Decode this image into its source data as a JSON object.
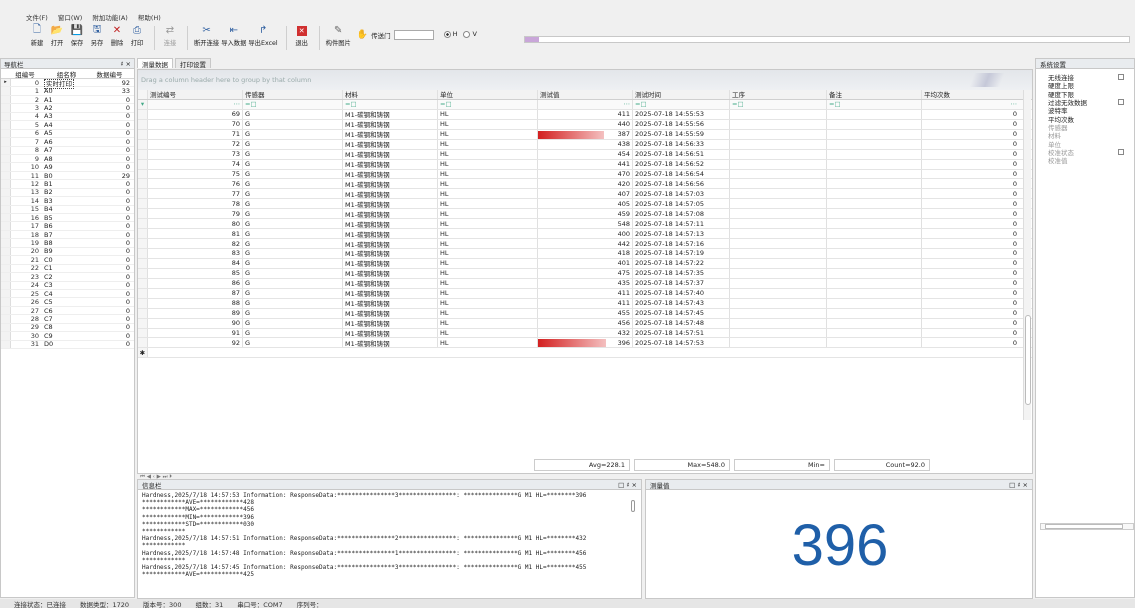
{
  "menu": [
    "文件(F)",
    "窗口(W)",
    "附加功能(A)",
    "帮助(H)"
  ],
  "toolbar": {
    "buttons": [
      {
        "label": "新建",
        "icon": "new-file-icon"
      },
      {
        "label": "打开",
        "icon": "open-folder-icon"
      },
      {
        "label": "保存",
        "icon": "save-icon"
      },
      {
        "label": "另存",
        "icon": "save-as-icon"
      },
      {
        "label": "删除",
        "icon": "delete-icon"
      },
      {
        "label": "打印",
        "icon": "print-icon"
      }
    ],
    "connect_label": "连接",
    "reconnect_label": "断开连接",
    "import_label": "导入数据",
    "export_label": "导出Excel",
    "exit_label": "退出",
    "image_label": "构件图片",
    "port_label": "传送门",
    "radio_h": "H",
    "radio_v": "V",
    "radio_selected": "H"
  },
  "nav": {
    "title": "导航栏",
    "pin": "♯",
    "close": "×",
    "headers": [
      "组编号",
      "组名称",
      "数据编号"
    ],
    "rows": [
      {
        "id": "0",
        "name": "实时打印",
        "count": "92",
        "selected": true
      },
      {
        "id": "1",
        "name": "A0",
        "count": "33"
      },
      {
        "id": "2",
        "name": "A1",
        "count": "0"
      },
      {
        "id": "3",
        "name": "A2",
        "count": "0"
      },
      {
        "id": "4",
        "name": "A3",
        "count": "0"
      },
      {
        "id": "5",
        "name": "A4",
        "count": "0"
      },
      {
        "id": "6",
        "name": "A5",
        "count": "0"
      },
      {
        "id": "7",
        "name": "A6",
        "count": "0"
      },
      {
        "id": "8",
        "name": "A7",
        "count": "0"
      },
      {
        "id": "9",
        "name": "A8",
        "count": "0"
      },
      {
        "id": "10",
        "name": "A9",
        "count": "0"
      },
      {
        "id": "11",
        "name": "B0",
        "count": "29"
      },
      {
        "id": "12",
        "name": "B1",
        "count": "0"
      },
      {
        "id": "13",
        "name": "B2",
        "count": "0"
      },
      {
        "id": "14",
        "name": "B3",
        "count": "0"
      },
      {
        "id": "15",
        "name": "B4",
        "count": "0"
      },
      {
        "id": "16",
        "name": "B5",
        "count": "0"
      },
      {
        "id": "17",
        "name": "B6",
        "count": "0"
      },
      {
        "id": "18",
        "name": "B7",
        "count": "0"
      },
      {
        "id": "19",
        "name": "B8",
        "count": "0"
      },
      {
        "id": "20",
        "name": "B9",
        "count": "0"
      },
      {
        "id": "21",
        "name": "C0",
        "count": "0"
      },
      {
        "id": "22",
        "name": "C1",
        "count": "0"
      },
      {
        "id": "23",
        "name": "C2",
        "count": "0"
      },
      {
        "id": "24",
        "name": "C3",
        "count": "0"
      },
      {
        "id": "25",
        "name": "C4",
        "count": "0"
      },
      {
        "id": "26",
        "name": "C5",
        "count": "0"
      },
      {
        "id": "27",
        "name": "C6",
        "count": "0"
      },
      {
        "id": "28",
        "name": "C7",
        "count": "0"
      },
      {
        "id": "29",
        "name": "C8",
        "count": "0"
      },
      {
        "id": "30",
        "name": "C9",
        "count": "0"
      },
      {
        "id": "31",
        "name": "D0",
        "count": "0"
      }
    ]
  },
  "tabs": [
    "测量数据",
    "打印设置"
  ],
  "grid": {
    "group_hint": "Drag a column header here to group by that column",
    "headers": [
      "测试编号",
      "传感器",
      "材料",
      "单位",
      "测试值",
      "测试时间",
      "工序",
      "备注",
      "平均次数"
    ],
    "filter_marks": [
      "⋯",
      "=□",
      "=□",
      "=□",
      "⋯",
      "=□",
      "=□",
      "=□",
      "⋯"
    ],
    "bar_max": 548,
    "rows": [
      {
        "no": "69",
        "sensor": "G",
        "material": "M1-碳钢和铸钢",
        "unit": "HL",
        "value": 411,
        "time": "2025-07-18 14:55:53",
        "avg": "0"
      },
      {
        "no": "70",
        "sensor": "G",
        "material": "M1-碳钢和铸钢",
        "unit": "HL",
        "value": 440,
        "time": "2025-07-18 14:55:56",
        "avg": "0"
      },
      {
        "no": "71",
        "sensor": "G",
        "material": "M1-碳钢和铸钢",
        "unit": "HL",
        "value": 387,
        "time": "2025-07-18 14:55:59",
        "avg": "0",
        "bar": true
      },
      {
        "no": "72",
        "sensor": "G",
        "material": "M1-碳钢和铸钢",
        "unit": "HL",
        "value": 438,
        "time": "2025-07-18 14:56:33",
        "avg": "0"
      },
      {
        "no": "73",
        "sensor": "G",
        "material": "M1-碳钢和铸钢",
        "unit": "HL",
        "value": 454,
        "time": "2025-07-18 14:56:51",
        "avg": "0"
      },
      {
        "no": "74",
        "sensor": "G",
        "material": "M1-碳钢和铸钢",
        "unit": "HL",
        "value": 441,
        "time": "2025-07-18 14:56:52",
        "avg": "0"
      },
      {
        "no": "75",
        "sensor": "G",
        "material": "M1-碳钢和铸钢",
        "unit": "HL",
        "value": 470,
        "time": "2025-07-18 14:56:54",
        "avg": "0"
      },
      {
        "no": "76",
        "sensor": "G",
        "material": "M1-碳钢和铸钢",
        "unit": "HL",
        "value": 420,
        "time": "2025-07-18 14:56:56",
        "avg": "0"
      },
      {
        "no": "77",
        "sensor": "G",
        "material": "M1-碳钢和铸钢",
        "unit": "HL",
        "value": 407,
        "time": "2025-07-18 14:57:03",
        "avg": "0"
      },
      {
        "no": "78",
        "sensor": "G",
        "material": "M1-碳钢和铸钢",
        "unit": "HL",
        "value": 405,
        "time": "2025-07-18 14:57:05",
        "avg": "0"
      },
      {
        "no": "79",
        "sensor": "G",
        "material": "M1-碳钢和铸钢",
        "unit": "HL",
        "value": 459,
        "time": "2025-07-18 14:57:08",
        "avg": "0"
      },
      {
        "no": "80",
        "sensor": "G",
        "material": "M1-碳钢和铸钢",
        "unit": "HL",
        "value": 548,
        "time": "2025-07-18 14:57:11",
        "avg": "0"
      },
      {
        "no": "81",
        "sensor": "G",
        "material": "M1-碳钢和铸钢",
        "unit": "HL",
        "value": 400,
        "time": "2025-07-18 14:57:13",
        "avg": "0"
      },
      {
        "no": "82",
        "sensor": "G",
        "material": "M1-碳钢和铸钢",
        "unit": "HL",
        "value": 442,
        "time": "2025-07-18 14:57:16",
        "avg": "0"
      },
      {
        "no": "83",
        "sensor": "G",
        "material": "M1-碳钢和铸钢",
        "unit": "HL",
        "value": 418,
        "time": "2025-07-18 14:57:19",
        "avg": "0"
      },
      {
        "no": "84",
        "sensor": "G",
        "material": "M1-碳钢和铸钢",
        "unit": "HL",
        "value": 401,
        "time": "2025-07-18 14:57:22",
        "avg": "0"
      },
      {
        "no": "85",
        "sensor": "G",
        "material": "M1-碳钢和铸钢",
        "unit": "HL",
        "value": 475,
        "time": "2025-07-18 14:57:35",
        "avg": "0"
      },
      {
        "no": "86",
        "sensor": "G",
        "material": "M1-碳钢和铸钢",
        "unit": "HL",
        "value": 435,
        "time": "2025-07-18 14:57:37",
        "avg": "0"
      },
      {
        "no": "87",
        "sensor": "G",
        "material": "M1-碳钢和铸钢",
        "unit": "HL",
        "value": 411,
        "time": "2025-07-18 14:57:40",
        "avg": "0"
      },
      {
        "no": "88",
        "sensor": "G",
        "material": "M1-碳钢和铸钢",
        "unit": "HL",
        "value": 411,
        "time": "2025-07-18 14:57:43",
        "avg": "0"
      },
      {
        "no": "89",
        "sensor": "G",
        "material": "M1-碳钢和铸钢",
        "unit": "HL",
        "value": 455,
        "time": "2025-07-18 14:57:45",
        "avg": "0"
      },
      {
        "no": "90",
        "sensor": "G",
        "material": "M1-碳钢和铸钢",
        "unit": "HL",
        "value": 456,
        "time": "2025-07-18 14:57:48",
        "avg": "0"
      },
      {
        "no": "91",
        "sensor": "G",
        "material": "M1-碳钢和铸钢",
        "unit": "HL",
        "value": 432,
        "time": "2025-07-18 14:57:51",
        "avg": "0"
      },
      {
        "no": "92",
        "sensor": "G",
        "material": "M1-碳钢和铸钢",
        "unit": "HL",
        "value": 396,
        "time": "2025-07-18 14:57:53",
        "avg": "0",
        "bar": true
      }
    ],
    "new_row_marker": "✱",
    "summary": [
      "Avg=228.1",
      "Max=548.0",
      "Min=",
      "Count=92.0"
    ],
    "pager": "⏮ ◀ ‹ ▶ ⏭ ⏵"
  },
  "info": {
    "title": "信息栏",
    "controls": "□ ♯ ×",
    "lines": [
      "Hardness,2025/7/18 14:57:53 Information: ResponseData:****************3****************: ***************G M1 HL=********396",
      "************AVE=************428",
      "************MAX=************456",
      "************MIN=************396",
      "************STD=************030",
      "************",
      "Hardness,2025/7/18 14:57:51 Information: ResponseData:****************2****************: ***************G M1 HL=********432",
      "************",
      "Hardness,2025/7/18 14:57:48 Information: ResponseData:****************1****************: ***************G M1 HL=********456",
      "************",
      "Hardness,2025/7/18 14:57:45 Information: ResponseData:****************3****************: ***************G M1 HL=********455",
      "************AVE=************425"
    ]
  },
  "measure": {
    "title": "测量值",
    "controls": "□ ♯ ×",
    "value": "396",
    "color": "#1f5fa8"
  },
  "settings": {
    "title": "系统设置",
    "rows": [
      {
        "label": "无线连接",
        "check": true
      },
      {
        "label": "硬度上限"
      },
      {
        "label": "硬度下限"
      },
      {
        "label": "过滤无效数据",
        "check": true
      },
      {
        "label": "波特率"
      },
      {
        "label": "平均次数"
      },
      {
        "label": "传感器",
        "dim": true
      },
      {
        "label": "材料",
        "dim": true
      },
      {
        "label": "单位",
        "dim": true
      },
      {
        "label": "校准状态",
        "dim": true,
        "check": true
      },
      {
        "label": "校准值",
        "dim": true
      }
    ]
  },
  "status": [
    "连接状态：已连接",
    "数据类型：1720",
    "版本号：300",
    "组数：31",
    "串口号：COM7",
    "序列号："
  ],
  "accent_bar_color": "#d32020"
}
